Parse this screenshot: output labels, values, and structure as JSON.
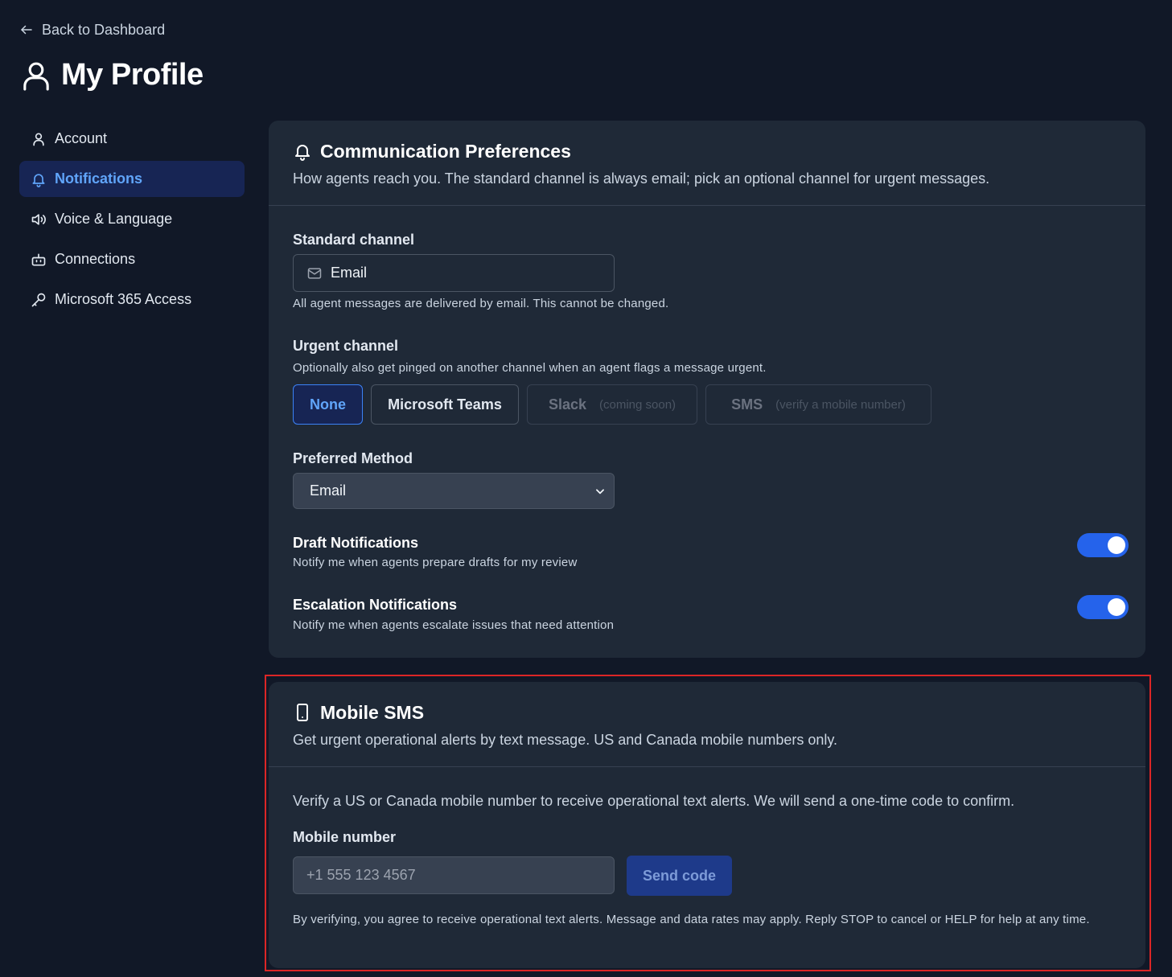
{
  "nav": {
    "back_label": "Back to Dashboard"
  },
  "page": {
    "title": "My Profile"
  },
  "sidebar": {
    "items": [
      {
        "label": "Account",
        "icon": "user-icon",
        "active": false
      },
      {
        "label": "Notifications",
        "icon": "bell-icon",
        "active": true
      },
      {
        "label": "Voice & Language",
        "icon": "speaker-icon",
        "active": false
      },
      {
        "label": "Connections",
        "icon": "bot-icon",
        "active": false
      },
      {
        "label": "Microsoft 365 Access",
        "icon": "key-icon",
        "active": false
      }
    ]
  },
  "comm": {
    "title": "Communication Preferences",
    "subtitle": "How agents reach you. The standard channel is always email; pick an optional channel for urgent messages.",
    "standard_label": "Standard channel",
    "standard_value": "Email",
    "standard_help": "All agent messages are delivered by email. This cannot be changed.",
    "urgent_label": "Urgent channel",
    "urgent_help": "Optionally also get pinged on another channel when an agent flags a message urgent.",
    "urgent_options": [
      {
        "label": "None",
        "note": "",
        "state": "selected"
      },
      {
        "label": "Microsoft Teams",
        "note": "",
        "state": "normal"
      },
      {
        "label": "Slack",
        "note": "(coming soon)",
        "state": "disabled"
      },
      {
        "label": "SMS",
        "note": "(verify a mobile number)",
        "state": "disabled"
      }
    ],
    "preferred_label": "Preferred Method",
    "preferred_value": "Email",
    "draft_title": "Draft Notifications",
    "draft_desc": "Notify me when agents prepare drafts for my review",
    "draft_on": true,
    "escalation_title": "Escalation Notifications",
    "escalation_desc": "Notify me when agents escalate issues that need attention",
    "escalation_on": true
  },
  "sms": {
    "title": "Mobile SMS",
    "subtitle": "Get urgent operational alerts by text message. US and Canada mobile numbers only.",
    "intro": "Verify a US or Canada mobile number to receive operational text alerts. We will send a one-time code to confirm.",
    "number_label": "Mobile number",
    "number_placeholder": "+1 555 123 4567",
    "send_label": "Send code",
    "legal": "By verifying, you agree to receive operational text alerts. Message and data rates may apply. Reply STOP to cancel or HELP for help at any time."
  },
  "colors": {
    "background": "#111827",
    "card": "#1f2937",
    "accent": "#2563eb",
    "active_text": "#60a5fa",
    "highlight_border": "#dc2626"
  }
}
